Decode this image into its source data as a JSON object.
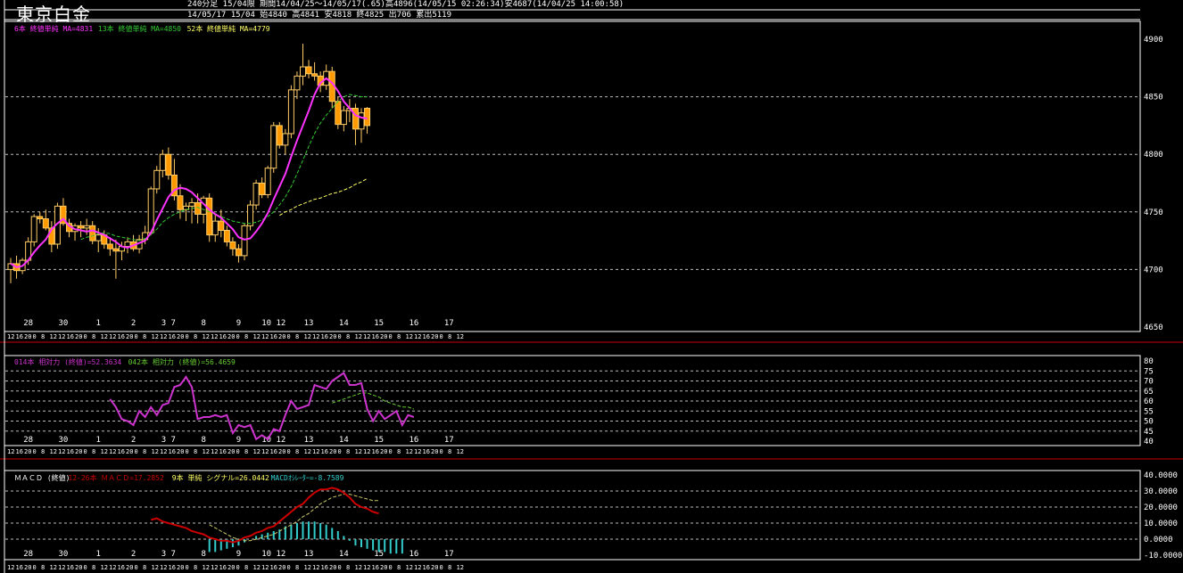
{
  "title": "東京白金",
  "header": {
    "line1": "240分足 15/04限 期間14/04/25～14/05/17(.65)高4896(14/05/15 02:26:34)安4687(14/04/25 14:00:58)",
    "line2": "14/05/17 15/04 始4840 高4841 安4818 終4825 出706 累出5119"
  },
  "colors": {
    "background": "#000000",
    "candle_up": "#000000",
    "candle_down": "#ff9900",
    "candle_outline": "#ffcc66",
    "ma6": "#ff33ff",
    "ma13": "#33cc33",
    "ma52": "#ffff66",
    "rsi14": "#cc33cc",
    "rsi42": "#66cc33",
    "macd": "#cc0000",
    "signal": "#cccc66",
    "oscillator": "#33cccc",
    "frame": "#ffffff",
    "divider": "#cc0000"
  },
  "legends": {
    "price": [
      {
        "text": "6本 終値単純 MA=4831",
        "color": "#ff33ff"
      },
      {
        "text": "13本 終値単純 MA=4850",
        "color": "#33cc33"
      },
      {
        "text": "52本 終値単純 MA=4779",
        "color": "#ffff66"
      }
    ],
    "rsi": [
      {
        "text": "014本 相対力 (終値)=52.3634",
        "color": "#cc33cc"
      },
      {
        "text": "042本 相対力 (終値)=56.4659",
        "color": "#66cc33"
      }
    ],
    "macd": [
      {
        "text": "ＭＡＣＤ (終値)",
        "color": "#ffffff"
      },
      {
        "text": "12-26本 ＭＡＣＤ=17.2852",
        "color": "#cc0000"
      },
      {
        "text": "9本 単純 シグナル=26.0442",
        "color": "#ffff66"
      },
      {
        "text": "MACDｵｼﾚｰﾀｰ=-8.7589",
        "color": "#33cccc"
      }
    ]
  },
  "day_labels": [
    {
      "i": 3,
      "t": "28"
    },
    {
      "i": 9,
      "t": "30"
    },
    {
      "i": 15,
      "t": "1"
    },
    {
      "i": 21,
      "t": "2"
    },
    {
      "i": 27,
      "t": "3 7"
    },
    {
      "i": 33,
      "t": "8"
    },
    {
      "i": 39,
      "t": "9"
    },
    {
      "i": 45,
      "t": "10 12"
    },
    {
      "i": 51,
      "t": "13"
    },
    {
      "i": 57,
      "t": "14"
    },
    {
      "i": 63,
      "t": "15"
    },
    {
      "i": 69,
      "t": "16"
    },
    {
      "i": 75,
      "t": "17"
    }
  ],
  "hour_labels": [
    "12",
    "16",
    "20",
    "0",
    "8",
    "12"
  ],
  "chart_data": [
    {
      "type": "candlestick",
      "title": "東京白金",
      "ylim": [
        4650,
        4900
      ],
      "yticks": [
        4650,
        4700,
        4750,
        4800,
        4850,
        4900
      ],
      "ohlc": [
        [
          4700,
          4710,
          4688,
          4705
        ],
        [
          4705,
          4712,
          4692,
          4699
        ],
        [
          4699,
          4710,
          4696,
          4708
        ],
        [
          4708,
          4728,
          4704,
          4724
        ],
        [
          4724,
          4748,
          4720,
          4746
        ],
        [
          4746,
          4750,
          4740,
          4744
        ],
        [
          4744,
          4752,
          4734,
          4736
        ],
        [
          4736,
          4742,
          4715,
          4722
        ],
        [
          4722,
          4758,
          4718,
          4755
        ],
        [
          4755,
          4762,
          4738,
          4740
        ],
        [
          4740,
          4744,
          4728,
          4733
        ],
        [
          4733,
          4740,
          4725,
          4738
        ],
        [
          4738,
          4742,
          4728,
          4736
        ],
        [
          4736,
          4744,
          4730,
          4738
        ],
        [
          4738,
          4742,
          4722,
          4725
        ],
        [
          4725,
          4736,
          4715,
          4730
        ],
        [
          4730,
          4734,
          4718,
          4722
        ],
        [
          4722,
          4728,
          4712,
          4718
        ],
        [
          4718,
          4726,
          4692,
          4716
        ],
        [
          4716,
          4724,
          4708,
          4720
        ],
        [
          4720,
          4728,
          4714,
          4724
        ],
        [
          4724,
          4730,
          4716,
          4718
        ],
        [
          4718,
          4730,
          4714,
          4726
        ],
        [
          4726,
          4738,
          4722,
          4732
        ],
        [
          4732,
          4772,
          4730,
          4770
        ],
        [
          4770,
          4790,
          4766,
          4786
        ],
        [
          4786,
          4804,
          4780,
          4800
        ],
        [
          4800,
          4806,
          4778,
          4782
        ],
        [
          4782,
          4796,
          4760,
          4764
        ],
        [
          4764,
          4774,
          4744,
          4752
        ],
        [
          4752,
          4758,
          4742,
          4755
        ],
        [
          4755,
          4762,
          4740,
          4758
        ],
        [
          4758,
          4766,
          4740,
          4748
        ],
        [
          4748,
          4764,
          4740,
          4762
        ],
        [
          4762,
          4766,
          4724,
          4730
        ],
        [
          4730,
          4748,
          4724,
          4742
        ],
        [
          4742,
          4752,
          4728,
          4734
        ],
        [
          4734,
          4738,
          4720,
          4724
        ],
        [
          4724,
          4728,
          4712,
          4718
        ],
        [
          4718,
          4722,
          4706,
          4712
        ],
        [
          4712,
          4740,
          4708,
          4738
        ],
        [
          4738,
          4760,
          4734,
          4756
        ],
        [
          4756,
          4778,
          4752,
          4775
        ],
        [
          4775,
          4780,
          4762,
          4765
        ],
        [
          4765,
          4790,
          4762,
          4788
        ],
        [
          4788,
          4828,
          4784,
          4825
        ],
        [
          4825,
          4828,
          4805,
          4808
        ],
        [
          4808,
          4822,
          4800,
          4818
        ],
        [
          4818,
          4860,
          4814,
          4856
        ],
        [
          4856,
          4872,
          4848,
          4868
        ],
        [
          4868,
          4896,
          4860,
          4876
        ],
        [
          4876,
          4882,
          4866,
          4870
        ],
        [
          4870,
          4880,
          4864,
          4868
        ],
        [
          4868,
          4872,
          4854,
          4860
        ],
        [
          4860,
          4878,
          4856,
          4872
        ],
        [
          4872,
          4876,
          4840,
          4846
        ],
        [
          4846,
          4850,
          4822,
          4826
        ],
        [
          4826,
          4842,
          4820,
          4838
        ],
        [
          4838,
          4848,
          4828,
          4840
        ],
        [
          4840,
          4844,
          4808,
          4822
        ],
        [
          4822,
          4840,
          4810,
          4836
        ],
        [
          4840,
          4841,
          4818,
          4825
        ]
      ],
      "ma6": [
        4705,
        4702,
        4703,
        4708,
        4715,
        4721,
        4726,
        4735,
        4740,
        4744,
        4738,
        4735,
        4734,
        4733,
        4734,
        4732,
        4730,
        4727,
        4724,
        4720,
        4719,
        4721,
        4723,
        4725,
        4732,
        4743,
        4753,
        4763,
        4769,
        4771,
        4770,
        4767,
        4762,
        4757,
        4752,
        4748,
        4745,
        4740,
        4735,
        4728,
        4726,
        4727,
        4733,
        4740,
        4749,
        4761,
        4772,
        4783,
        4798,
        4812,
        4825,
        4838,
        4852,
        4862,
        4866,
        4862,
        4855,
        4846,
        4840,
        4834,
        4832,
        4831
      ],
      "ma13": [
        null,
        null,
        null,
        null,
        null,
        null,
        null,
        null,
        null,
        null,
        null,
        null,
        4726,
        4728,
        4729,
        4731,
        4732,
        4731,
        4729,
        4728,
        4727,
        4726,
        4725,
        4727,
        4730,
        4735,
        4741,
        4745,
        4748,
        4750,
        4752,
        4753,
        4754,
        4752,
        4750,
        4748,
        4746,
        4744,
        4742,
        4741,
        4740,
        4740,
        4741,
        4743,
        4746,
        4750,
        4756,
        4763,
        4772,
        4783,
        4795,
        4807,
        4818,
        4827,
        4834,
        4840,
        4846,
        4850,
        4852,
        4851,
        4850,
        4850
      ],
      "ma52": [
        null,
        null,
        null,
        null,
        null,
        null,
        null,
        null,
        null,
        null,
        null,
        null,
        null,
        null,
        null,
        null,
        null,
        null,
        null,
        null,
        null,
        null,
        null,
        null,
        null,
        null,
        null,
        null,
        null,
        null,
        null,
        null,
        null,
        null,
        null,
        null,
        null,
        null,
        null,
        null,
        null,
        null,
        null,
        null,
        null,
        null,
        4747,
        4750,
        4752,
        4755,
        4757,
        4759,
        4761,
        4762,
        4764,
        4766,
        4767,
        4769,
        4771,
        4774,
        4776,
        4779
      ]
    },
    {
      "type": "line",
      "title": "相対力",
      "ylim": [
        40,
        80
      ],
      "yticks": [
        40,
        45,
        50,
        55,
        60,
        65,
        70,
        75,
        80
      ],
      "series": [
        {
          "name": "014本 相対力 (終値)",
          "values": [
            null,
            null,
            null,
            null,
            null,
            null,
            null,
            null,
            null,
            null,
            null,
            null,
            null,
            null,
            null,
            null,
            null,
            null,
            null,
            null,
            61,
            57,
            51,
            50,
            48,
            55,
            52,
            57,
            53,
            58,
            59,
            67,
            68,
            72,
            67,
            51,
            52,
            52,
            53,
            52,
            53,
            44,
            48,
            47,
            48,
            41,
            43,
            41,
            46,
            45,
            53,
            60,
            56,
            57,
            58,
            68,
            67,
            66,
            70,
            72,
            74,
            68,
            68,
            69,
            56,
            50,
            55,
            51,
            53,
            55,
            48,
            53,
            52
          ]
        },
        {
          "name": "042本 相対力 (終値)",
          "values": [
            null,
            null,
            null,
            null,
            null,
            null,
            null,
            null,
            null,
            null,
            null,
            null,
            null,
            null,
            null,
            null,
            null,
            null,
            null,
            null,
            null,
            null,
            null,
            null,
            null,
            null,
            null,
            null,
            null,
            null,
            null,
            null,
            null,
            null,
            null,
            null,
            null,
            null,
            null,
            null,
            null,
            null,
            null,
            null,
            null,
            null,
            null,
            null,
            null,
            null,
            null,
            null,
            null,
            null,
            null,
            null,
            null,
            null,
            59,
            60,
            61,
            62,
            63,
            64,
            64,
            63,
            62,
            60,
            59,
            58,
            57,
            57,
            56
          ]
        }
      ]
    },
    {
      "type": "line",
      "title": "ＭＡＣＤ",
      "ylim": [
        -10,
        40
      ],
      "yticks": [
        -10,
        0,
        10,
        20,
        30,
        40
      ],
      "series": [
        {
          "name": "MACD",
          "values": [
            null,
            null,
            null,
            null,
            null,
            null,
            null,
            null,
            null,
            null,
            null,
            null,
            null,
            null,
            null,
            null,
            null,
            null,
            null,
            null,
            null,
            null,
            null,
            null,
            null,
            null,
            null,
            null,
            12,
            13,
            11,
            10,
            9,
            8,
            7,
            5,
            4,
            3,
            1,
            0,
            -1,
            -1,
            -2,
            -1,
            1,
            2,
            4,
            5,
            7,
            8,
            11,
            14,
            17,
            20,
            22,
            26,
            29,
            31,
            31,
            32,
            31,
            29,
            26,
            22,
            20,
            19,
            17,
            16
          ]
        },
        {
          "name": "シグナル",
          "values": [
            null,
            null,
            null,
            null,
            null,
            null,
            null,
            null,
            null,
            null,
            null,
            null,
            null,
            null,
            null,
            null,
            null,
            null,
            null,
            null,
            null,
            null,
            null,
            null,
            null,
            null,
            null,
            null,
            null,
            null,
            null,
            null,
            null,
            null,
            null,
            null,
            null,
            null,
            9,
            7,
            5,
            3,
            1,
            0,
            -1,
            -1,
            0,
            1,
            2,
            3,
            5,
            7,
            9,
            11,
            14,
            16,
            19,
            22,
            24,
            26,
            27,
            28,
            28,
            27,
            26,
            25,
            24,
            24
          ]
        },
        {
          "name": "MACDｵｼﾚｰﾀｰ",
          "values": [
            null,
            null,
            null,
            null,
            null,
            null,
            null,
            null,
            null,
            null,
            null,
            null,
            null,
            null,
            null,
            null,
            null,
            null,
            null,
            null,
            null,
            null,
            null,
            null,
            null,
            null,
            null,
            null,
            null,
            null,
            null,
            null,
            null,
            null,
            null,
            null,
            null,
            null,
            -8,
            -8,
            -7,
            -6,
            -5,
            -4,
            -2,
            0,
            2,
            3,
            4,
            5,
            6,
            8,
            9,
            10,
            11,
            11,
            11,
            10,
            9,
            7,
            5,
            2,
            -1,
            -4,
            -5,
            -6,
            -7,
            -8,
            -8,
            -9,
            -9,
            -9
          ]
        }
      ]
    }
  ]
}
